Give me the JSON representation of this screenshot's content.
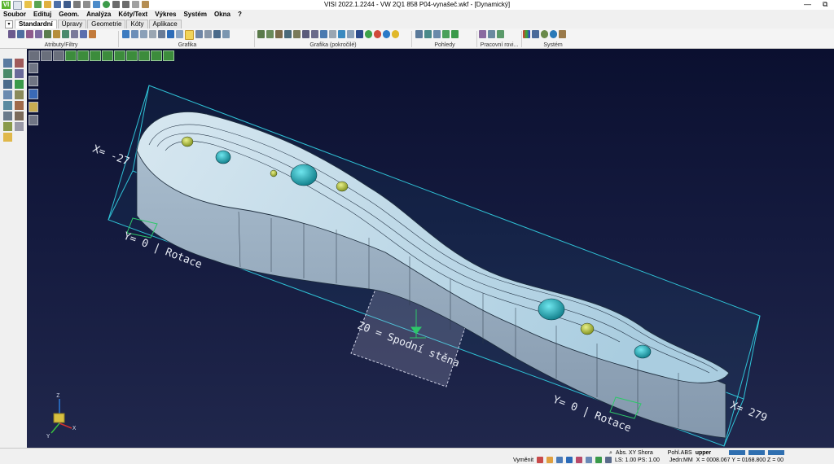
{
  "titlebar": {
    "app_logo": "VI",
    "title": "VISI 2022.1.2244 - VW 2Q1 858 P04-vynašeč.wkf - [Dynamický]",
    "minimize": "—",
    "restore": "⧉"
  },
  "menu": [
    "Soubor",
    "Edituj",
    "Geom.",
    "Analýza",
    "Kóty/Text",
    "Výkres",
    "Systém",
    "Okna",
    "?"
  ],
  "tabs": [
    "Standardní",
    "Úpravy",
    "Geometrie",
    "Kóty",
    "Aplikace"
  ],
  "active_tab": "Standardní",
  "ribbon_groups": {
    "attributes": "Atributy/Filtry",
    "graphics": "Grafika",
    "graphics_adv": "Grafika (pokročilé)",
    "views": "Pohledy",
    "workplanes": "Pracovní rovi...",
    "system": "Systém"
  },
  "viewport": {
    "labels": {
      "x_neg": "X= -27",
      "y_left": "Y= 0 | Rotace",
      "z0": "Z0 = Spodní stěna",
      "y_right": "Y= 0 | Rotace",
      "x_pos": "X= 279"
    },
    "axis": {
      "x": "X",
      "y": "Y",
      "z": "Z"
    }
  },
  "status": {
    "view": "Abs. XY Shora",
    "pohl": "Pohl.ABS",
    "upper": "upper",
    "replace": "Vyměnit",
    "ls": "LS: 1.00 PS: 1.00",
    "units": "Jedn:MM",
    "coords": "X = 0008.067 Y = 0168.800 Z = 00"
  },
  "colors": {
    "viewport_top": "#0b1030",
    "part_top": "#b9d9e8",
    "part_side": "#9fb2c4",
    "bbox": "#2fc2d6",
    "hole_yellow": "#b8c93a",
    "hole_teal": "#1fb4c1"
  }
}
